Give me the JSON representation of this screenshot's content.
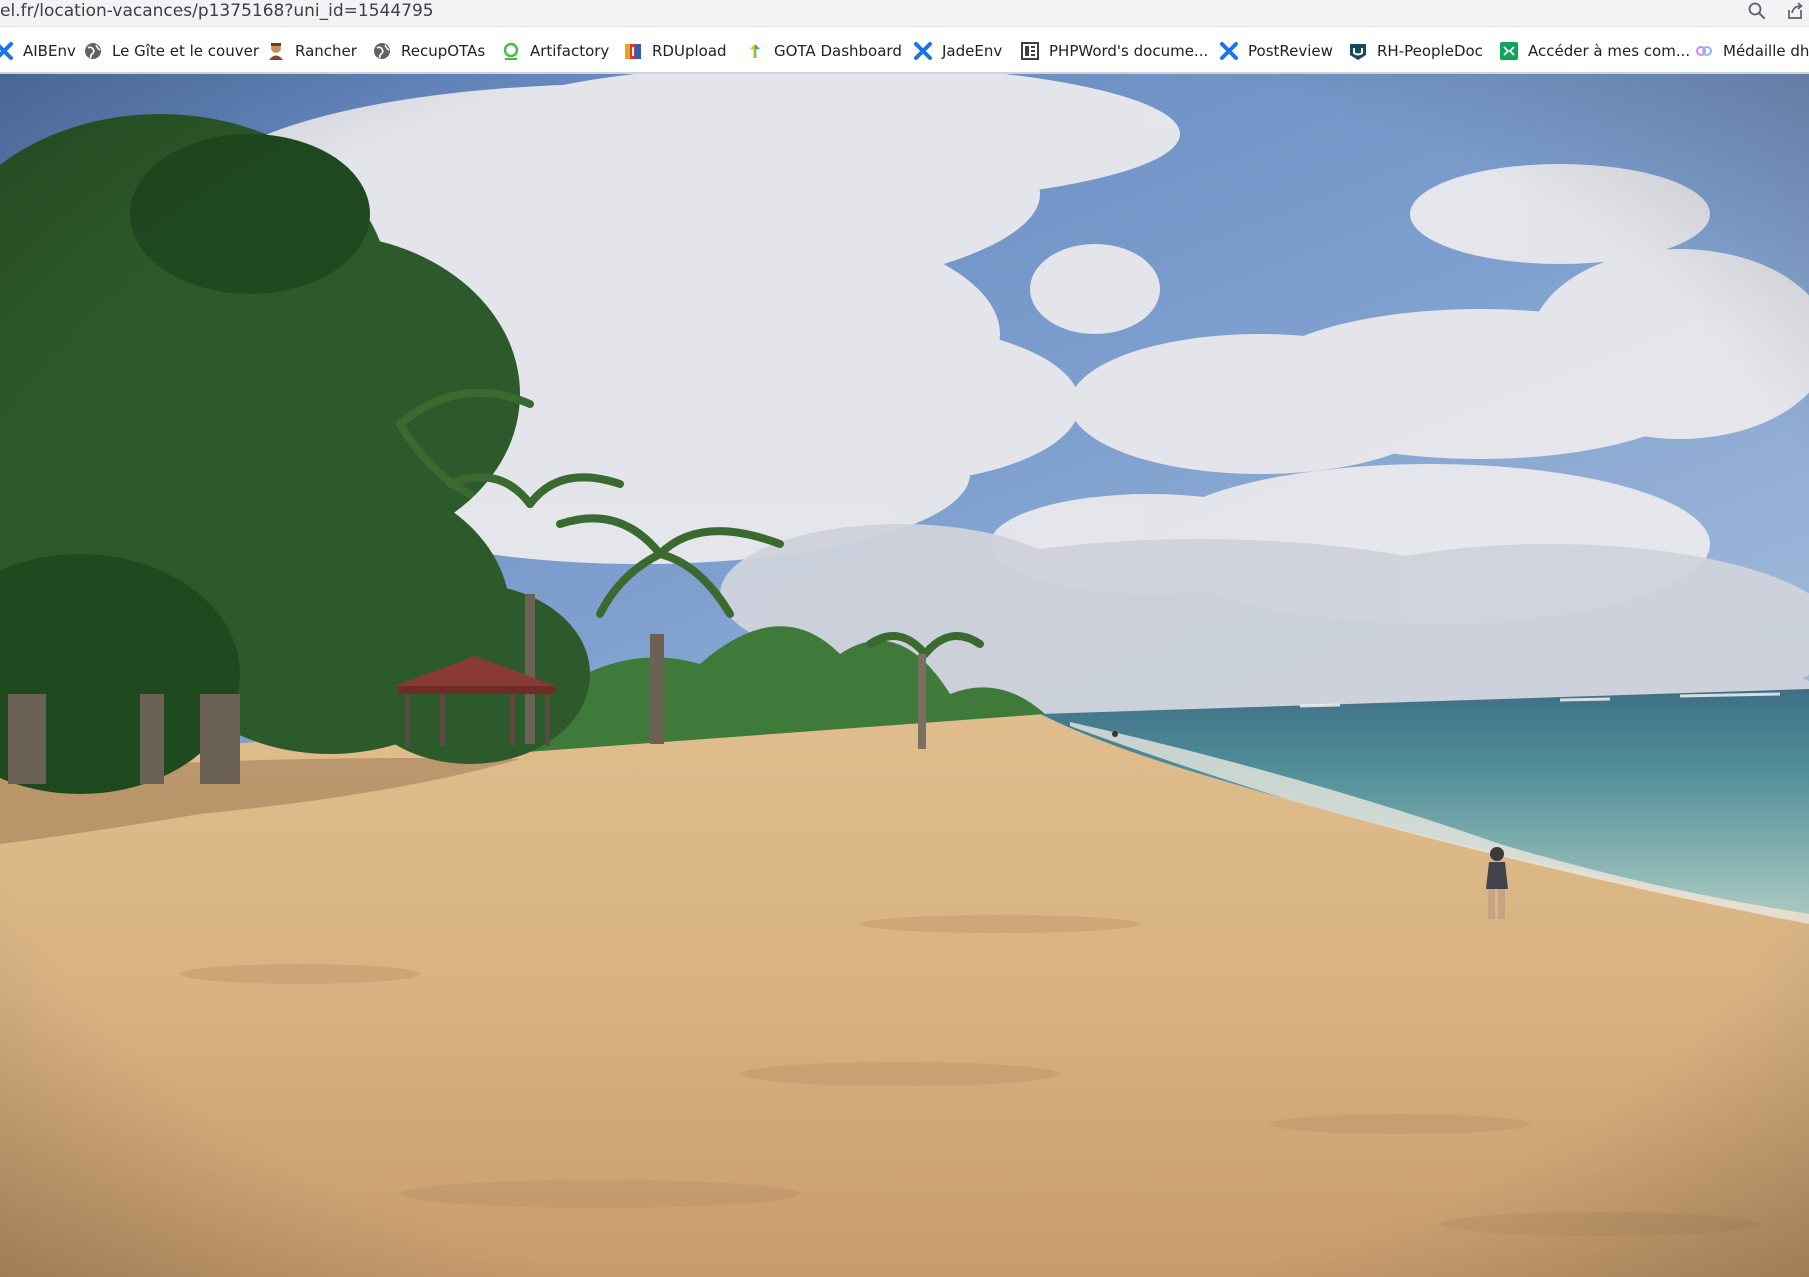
{
  "address_bar": {
    "url": "el.fr/location-vacances/p1375168?uni_id=1544795",
    "icons": [
      "zoom-icon",
      "share-icon"
    ]
  },
  "bookmarks": [
    {
      "label": "AIBEnv",
      "icon": "x-logo-icon",
      "color": "#1a73e8"
    },
    {
      "label": "Le Gîte et le couver",
      "icon": "globe-icon",
      "color": "#5f6368"
    },
    {
      "label": "Rancher",
      "icon": "avatar-icon",
      "color": "#a36a3f"
    },
    {
      "label": "RecupOTAs",
      "icon": "globe-icon",
      "color": "#5f6368"
    },
    {
      "label": "Artifactory",
      "icon": "artifactory-icon",
      "color": "#40be46"
    },
    {
      "label": "RDUpload",
      "icon": "rdupload-icon",
      "color": "#e8a317"
    },
    {
      "label": "GOTA Dashboard",
      "icon": "gota-icon",
      "color": "#1ca7e0"
    },
    {
      "label": "JadeEnv",
      "icon": "x-logo-icon",
      "color": "#1a73e8"
    },
    {
      "label": "PHPWord's docume...",
      "icon": "document-icon",
      "color": "#3c4043"
    },
    {
      "label": "PostReview",
      "icon": "x-logo-icon",
      "color": "#1a73e8"
    },
    {
      "label": "RH-PeopleDoc",
      "icon": "peopledoc-icon",
      "color": "#174a5a"
    },
    {
      "label": "Accéder à mes com...",
      "icon": "spreadsheet-icon",
      "color": "#10a35a"
    },
    {
      "label": "Médaille dho",
      "icon": "link-icon",
      "color": "#c58af9"
    }
  ],
  "photo": {
    "subject": "beach-photo"
  }
}
